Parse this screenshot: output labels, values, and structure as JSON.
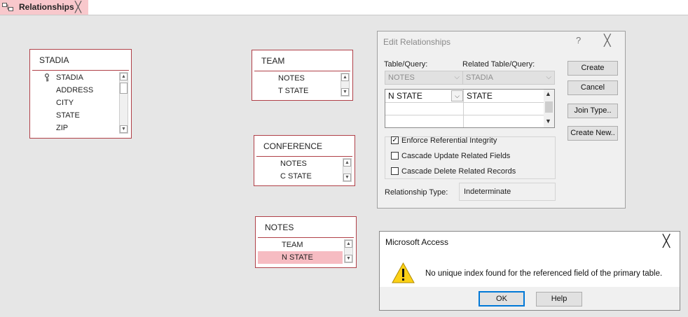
{
  "tab": {
    "label": "Relationships",
    "close": "╳"
  },
  "tables": {
    "stadia": {
      "title": "STADIA",
      "fields": [
        "STADIA",
        "ADDRESS",
        "CITY",
        "STATE",
        "ZIP"
      ]
    },
    "team": {
      "title": "TEAM",
      "fields": [
        "NOTES",
        "T STATE"
      ]
    },
    "conference": {
      "title": "CONFERENCE",
      "fields": [
        "NOTES",
        "C STATE"
      ]
    },
    "notes": {
      "title": "NOTES",
      "fields": [
        "TEAM",
        "N STATE"
      ],
      "selected_field": "N STATE"
    }
  },
  "edit_dialog": {
    "title": "Edit Relationships",
    "help": "?",
    "close": "╳",
    "table_label": "Table/Query:",
    "related_label": "Related Table/Query:",
    "table_value": "NOTES",
    "related_value": "STADIA",
    "grid": {
      "left_field": "N STATE",
      "right_field": "STATE"
    },
    "checkboxes": {
      "enforce": {
        "label": "Enforce Referential Integrity",
        "checked": true
      },
      "cascade_update": {
        "label": "Cascade Update Related Fields",
        "checked": false
      },
      "cascade_delete": {
        "label": "Cascade Delete Related Records",
        "checked": false
      }
    },
    "reltype_label": "Relationship Type:",
    "reltype_value": "Indeterminate",
    "buttons": {
      "create": "Create",
      "cancel": "Cancel",
      "join_type": "Join Type..",
      "create_new": "Create New.."
    }
  },
  "message_box": {
    "title": "Microsoft Access",
    "close": "╳",
    "icon": "warning-icon",
    "text": "No unique index found for the referenced field of the primary table.",
    "ok": "OK",
    "help": "Help"
  }
}
